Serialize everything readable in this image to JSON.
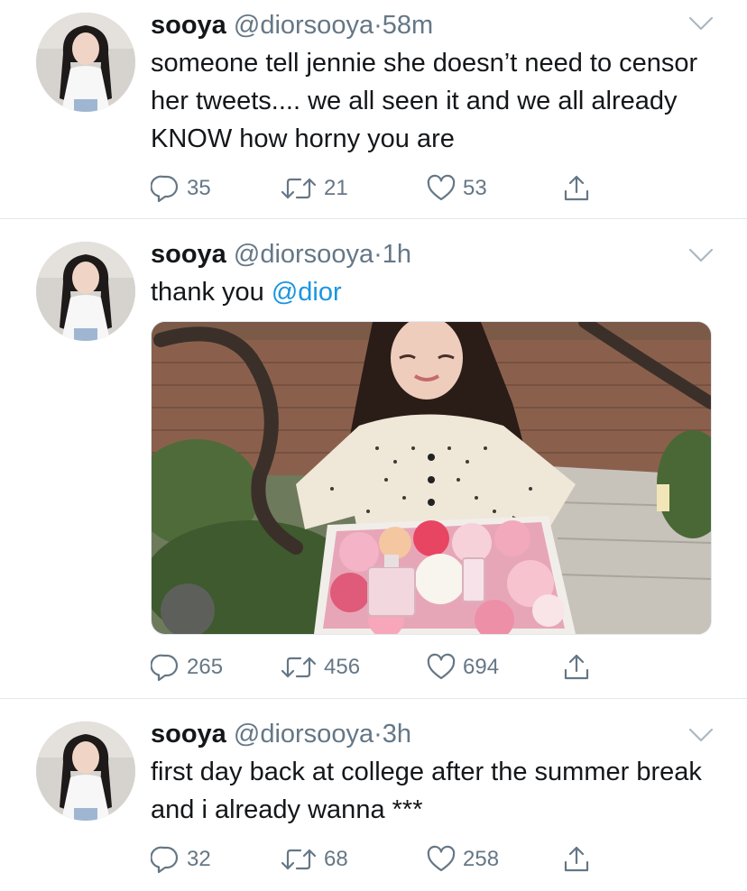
{
  "tweets": [
    {
      "name": "sooya",
      "handle": "@diorsooya",
      "dot": "·",
      "time": "58m",
      "text": "someone tell jennie she doesn’t need to censor her tweets.... we all seen it and we all already KNOW how horny you are",
      "mention": "",
      "replies": "35",
      "retweets": "21",
      "likes": "53"
    },
    {
      "name": "sooya",
      "handle": "@diorsooya",
      "dot": "·",
      "time": "1h",
      "text": "thank you ",
      "mention": "@dior",
      "replies": "265",
      "retweets": "456",
      "likes": "694"
    },
    {
      "name": "sooya",
      "handle": "@diorsooya",
      "dot": "·",
      "time": "3h",
      "text": "first day back at college after the summer break and i already wanna ***",
      "mention": "",
      "replies": "32",
      "retweets": "68",
      "likes": "258"
    }
  ],
  "icons": {
    "reply": "reply-icon",
    "retweet": "retweet-icon",
    "like": "heart-icon",
    "share": "share-icon",
    "menu": "chevron-down-icon"
  },
  "colors": {
    "text": "#14171a",
    "secondary": "#657786",
    "link": "#1b95e0",
    "divider": "#e1e8ed"
  }
}
